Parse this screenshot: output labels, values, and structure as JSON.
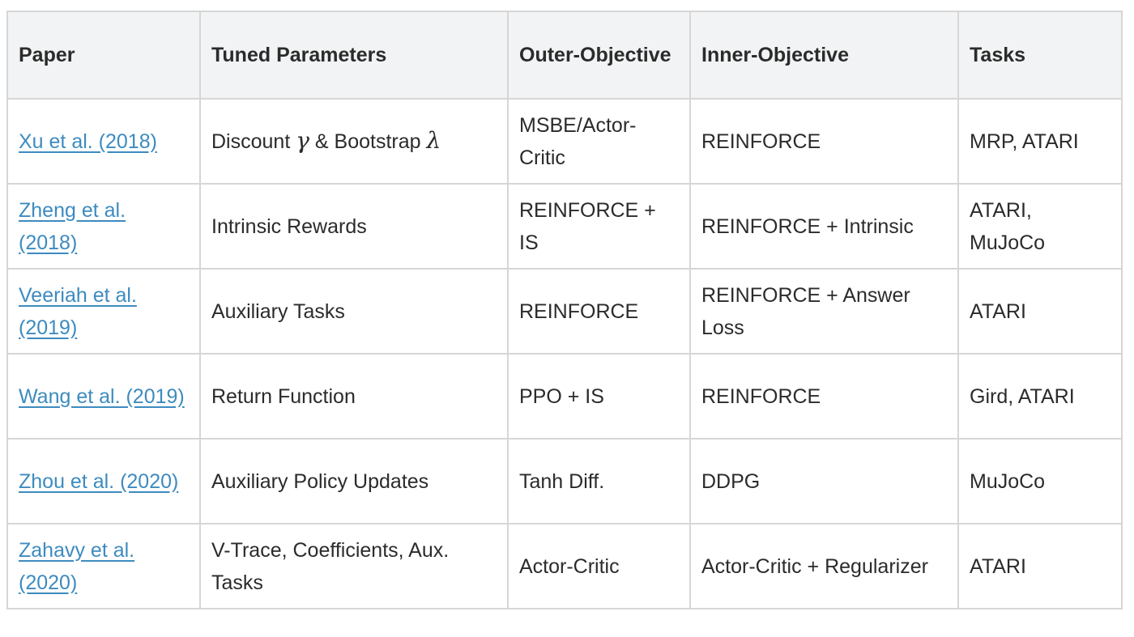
{
  "table": {
    "headers": [
      "Paper",
      "Tuned Parameters",
      "Outer-Objective",
      "Inner-Objective",
      "Tasks"
    ],
    "rows": [
      {
        "paper": "Xu et al. (2018)",
        "params_prefix": "Discount ",
        "params_sym1": "γ",
        "params_middle": " & Bootstrap ",
        "params_sym2": "λ",
        "outer": "MSBE/Actor-Critic",
        "inner": "REINFORCE",
        "tasks": "MRP, ATARI"
      },
      {
        "paper": "Zheng et al. (2018)",
        "params": "Intrinsic Rewards",
        "outer": "REINFORCE + IS",
        "inner": "REINFORCE + Intrinsic",
        "tasks": "ATARI, MuJoCo"
      },
      {
        "paper": "Veeriah et al. (2019)",
        "params": "Auxiliary Tasks",
        "outer": "REINFORCE",
        "inner": "REINFORCE + Answer Loss",
        "tasks": "ATARI"
      },
      {
        "paper": "Wang et al. (2019)",
        "params": "Return Function",
        "outer": "PPO + IS",
        "inner": "REINFORCE",
        "tasks": "Gird, ATARI"
      },
      {
        "paper": "Zhou et al. (2020)",
        "params": "Auxiliary Policy Updates",
        "outer": "Tanh Diff.",
        "inner": "DDPG",
        "tasks": "MuJoCo"
      },
      {
        "paper": "Zahavy et al. (2020)",
        "params": "V-Trace, Coefficients, Aux. Tasks",
        "outer": "Actor-Critic",
        "inner": "Actor-Critic + Regularizer",
        "tasks": "ATARI"
      }
    ]
  },
  "colors": {
    "link": "#3d8bbf",
    "header_bg": "#f2f3f4",
    "border": "#d6d6d6",
    "text": "#2b2b2b"
  }
}
